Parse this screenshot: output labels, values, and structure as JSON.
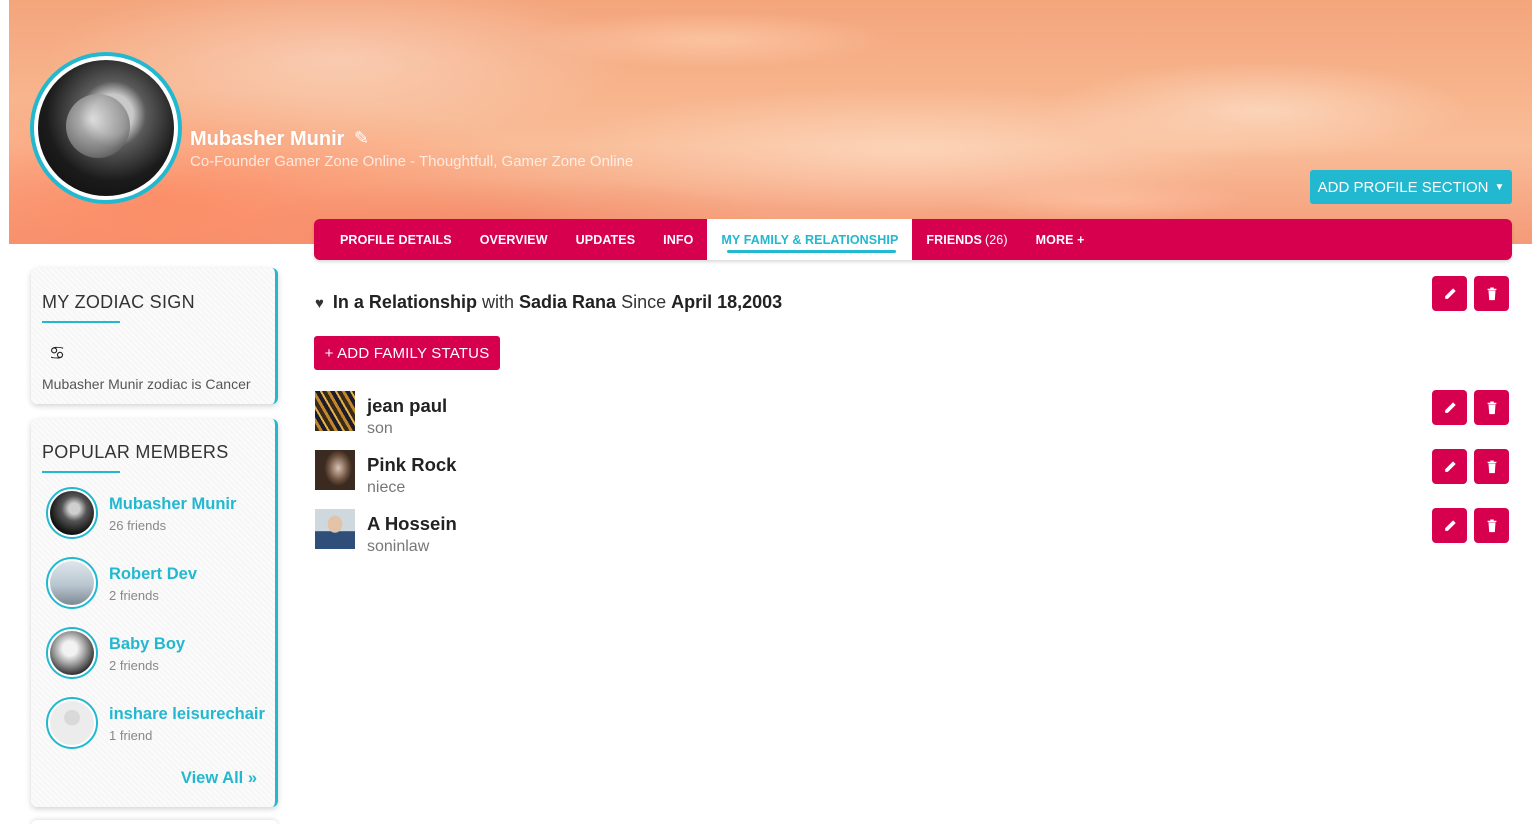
{
  "profile": {
    "name": "Mubasher Munir",
    "tagline": "Co-Founder Gamer Zone Online - Thoughtfull, Gamer Zone Online",
    "add_section_label": "ADD PROFILE SECTION"
  },
  "tabs": [
    {
      "label": "PROFILE DETAILS"
    },
    {
      "label": "OVERVIEW"
    },
    {
      "label": "UPDATES"
    },
    {
      "label": "INFO"
    },
    {
      "label": "MY FAMILY & RELATIONSHIP",
      "active": true
    },
    {
      "label": "FRIENDS",
      "count": "(26)"
    },
    {
      "label": "MORE +"
    }
  ],
  "zodiac": {
    "title": "MY ZODIAC SIGN",
    "symbol": "♋",
    "text": "Mubasher Munir zodiac is Cancer"
  },
  "popular": {
    "title": "POPULAR MEMBERS",
    "members": [
      {
        "name": "Mubasher Munir",
        "meta": "26 friends"
      },
      {
        "name": "Robert Dev",
        "meta": "2 friends"
      },
      {
        "name": "Baby Boy",
        "meta": "2 friends"
      },
      {
        "name": "inshare leisurechair",
        "meta": "1 friend"
      }
    ],
    "view_all": "View All »"
  },
  "relationship": {
    "status": "In a Relationship",
    "with_word": "with",
    "partner": "Sadia Rana",
    "since_word": "Since",
    "date": "April 18,2003"
  },
  "add_family_label": "+ ADD FAMILY STATUS",
  "family": [
    {
      "name": "jean paul",
      "relation": "son"
    },
    {
      "name": "Pink Rock",
      "relation": "niece"
    },
    {
      "name": "A Hossein",
      "relation": "soninlaw"
    }
  ],
  "colors": {
    "accent": "#22b8cf",
    "brand": "#d6004f"
  },
  "icons": {
    "edit": "pencil-icon",
    "delete": "trash-icon",
    "heart": "heart-icon"
  }
}
